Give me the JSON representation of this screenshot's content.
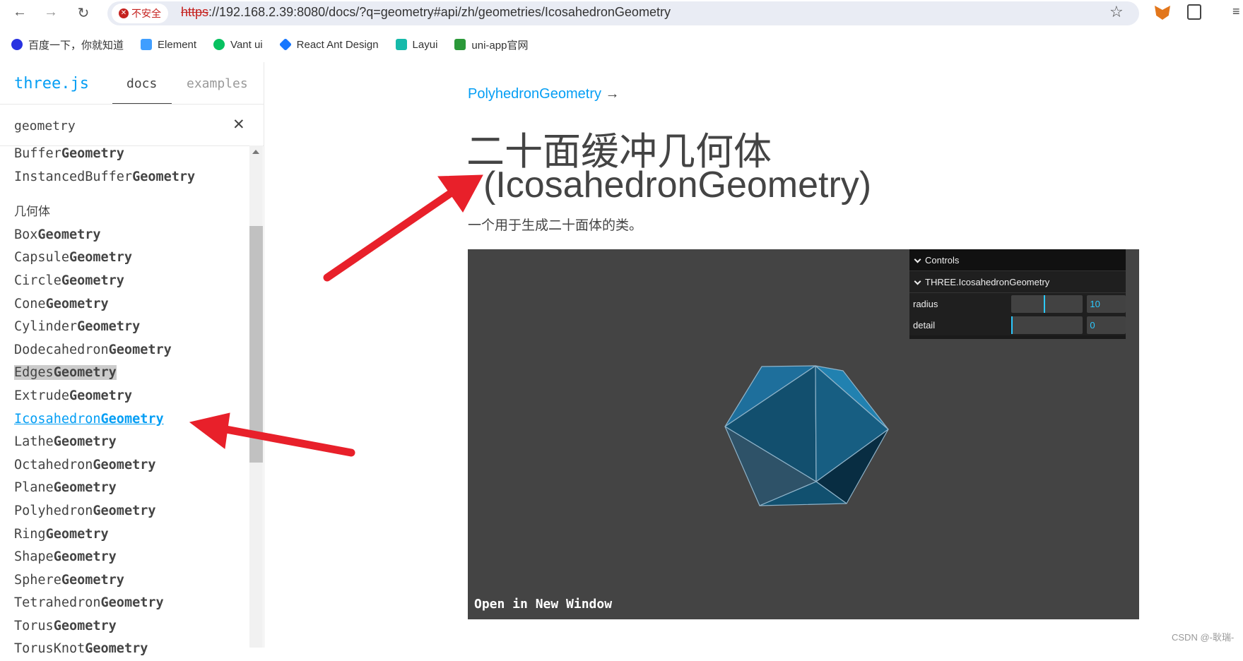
{
  "browser": {
    "security_label": "不安全",
    "url_scheme": "https",
    "url_rest": "://192.168.2.39:8080/docs/?q=geometry#api/zh/geometries/IcosahedronGeometry",
    "bookmarks": [
      {
        "label": "百度一下，你就知道",
        "color": "#2932e1"
      },
      {
        "label": "Element",
        "color": "#409eff"
      },
      {
        "label": "Vant ui",
        "color": "#07c160"
      },
      {
        "label": "React Ant Design",
        "color": "#1677ff"
      },
      {
        "label": "Layui",
        "color": "#16baaa"
      },
      {
        "label": "uni-app官网",
        "color": "#2b9939"
      }
    ]
  },
  "sidebar": {
    "logo": "three.js",
    "tabs": [
      {
        "label": "docs",
        "active": true
      },
      {
        "label": "examples",
        "active": false
      }
    ],
    "search_value": "geometry",
    "items": [
      {
        "pre": "Buffer",
        "bold": "Geometry"
      },
      {
        "pre": "InstancedBuffer",
        "bold": "Geometry"
      }
    ],
    "category": "几何体",
    "geometries": [
      {
        "pre": "Box",
        "bold": "Geometry"
      },
      {
        "pre": "Capsule",
        "bold": "Geometry"
      },
      {
        "pre": "Circle",
        "bold": "Geometry"
      },
      {
        "pre": "Cone",
        "bold": "Geometry"
      },
      {
        "pre": "Cylinder",
        "bold": "Geometry"
      },
      {
        "pre": "Dodecahedron",
        "bold": "Geometry"
      },
      {
        "pre": "Edges",
        "bold": "Geometry",
        "state": "hover"
      },
      {
        "pre": "Extrude",
        "bold": "Geometry"
      },
      {
        "pre": "Icosahedron",
        "bold": "Geometry",
        "state": "active"
      },
      {
        "pre": "Lathe",
        "bold": "Geometry"
      },
      {
        "pre": "Octahedron",
        "bold": "Geometry"
      },
      {
        "pre": "Plane",
        "bold": "Geometry"
      },
      {
        "pre": "Polyhedron",
        "bold": "Geometry"
      },
      {
        "pre": "Ring",
        "bold": "Geometry"
      },
      {
        "pre": "Shape",
        "bold": "Geometry"
      },
      {
        "pre": "Sphere",
        "bold": "Geometry"
      },
      {
        "pre": "Tetrahedron",
        "bold": "Geometry"
      },
      {
        "pre": "Torus",
        "bold": "Geometry"
      },
      {
        "pre": "TorusKnot",
        "bold": "Geometry"
      }
    ]
  },
  "main": {
    "parent_link": "PolyhedronGeometry",
    "arrow": "→",
    "title_zh": "二十面缓冲几何体",
    "title_en": "(IcosahedronGeometry)",
    "description": "一个用于生成二十面体的类。",
    "open_window": "Open in New Window",
    "gui": {
      "header": "Controls",
      "folder": "THREE.IcosahedronGeometry",
      "params": [
        {
          "label": "radius",
          "value": "10",
          "fraction": 0.45
        },
        {
          "label": "detail",
          "value": "0",
          "fraction": 0
        }
      ]
    }
  },
  "colors": {
    "accent": "#049ef4",
    "annotation_arrow": "#e8202a",
    "viewer_bg": "#444444",
    "mesh": "#156289"
  },
  "watermark": "CSDN @-耿瑞-"
}
